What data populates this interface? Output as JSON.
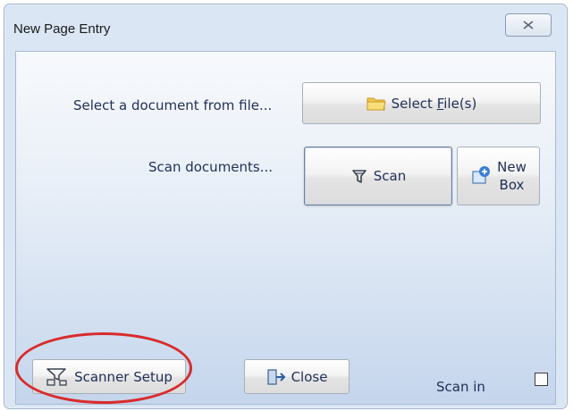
{
  "window": {
    "title": "New Page Entry",
    "close_glyph": "⌧"
  },
  "rows": {
    "file_label": "Select a document from file...",
    "scan_label": "Scan documents..."
  },
  "buttons": {
    "select_files": {
      "pre": "Select ",
      "accel": "F",
      "post": "ile(s)",
      "icon": "folder-icon"
    },
    "scan": {
      "label": "Scan",
      "icon": "scanner-icon"
    },
    "new_box": {
      "line1": "New",
      "line2": "Box",
      "icon": "new-box-icon"
    },
    "scanner_setup": {
      "label": "Scanner Setup",
      "icon": "scanner-setup-icon"
    },
    "close": {
      "label": "Close",
      "icon": "exit-door-icon"
    }
  },
  "scan_in": {
    "label": "Scan in",
    "checked": false
  },
  "annotation": {
    "color": "#d92b2b",
    "shape": "ellipse"
  }
}
